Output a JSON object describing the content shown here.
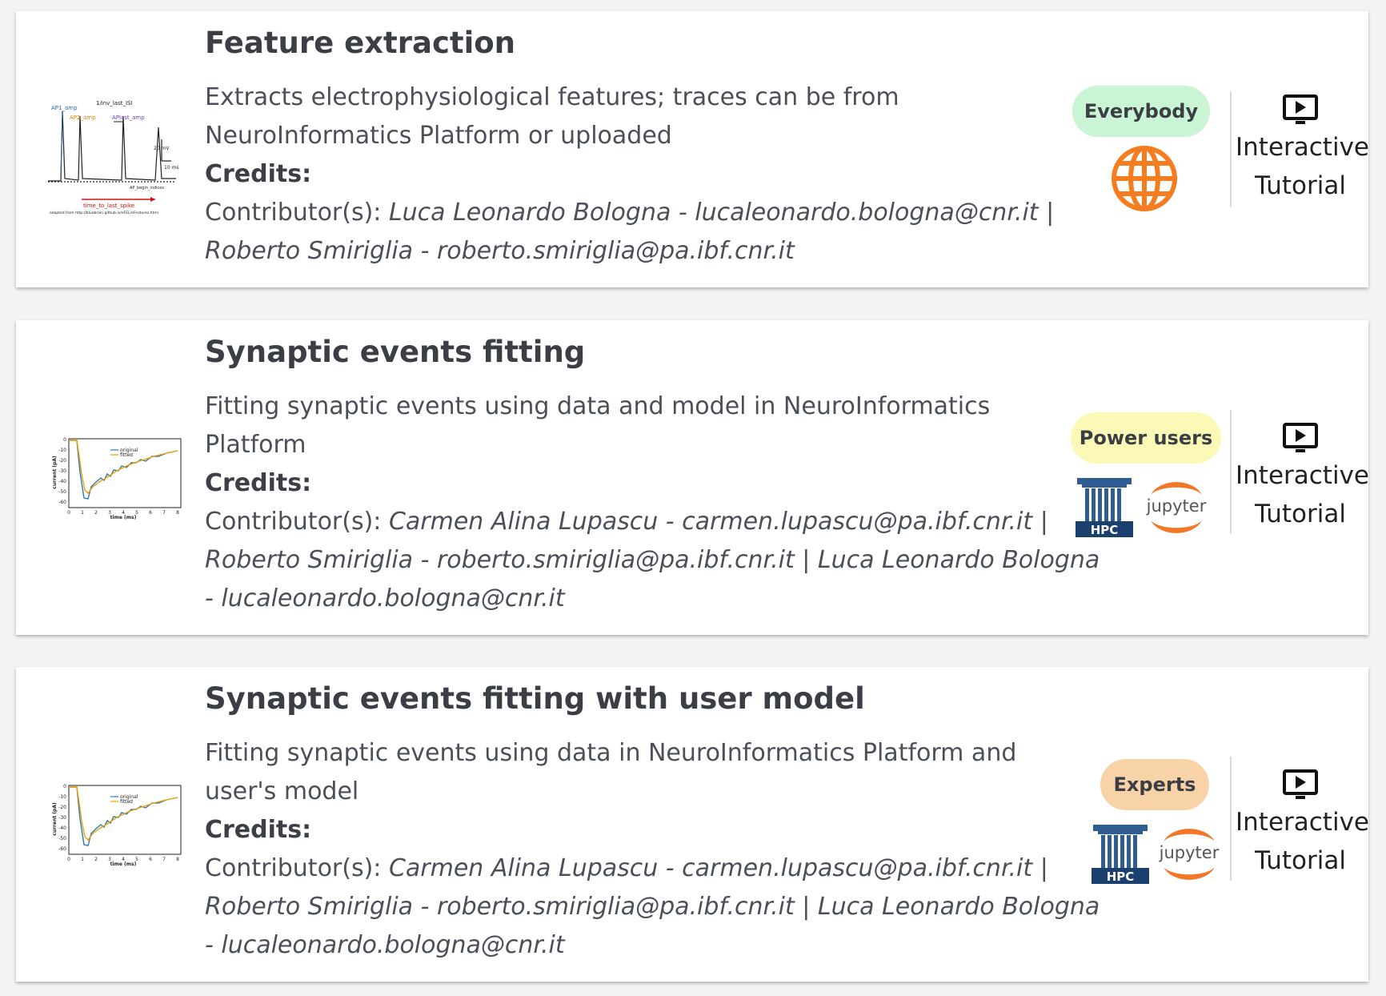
{
  "cards": [
    {
      "title": "Feature extraction",
      "description": "Extracts electrophysiological features; traces can be from NeuroInformatics Platform or uploaded",
      "credits_label": "Credits:",
      "contributors_prefix": "Contributor(s):",
      "contributors": "Luca Leonardo Bologna - lucaleonardo.bologna@cnr.it | Roberto Smiriglia - roberto.smiriglia@pa.ibf.cnr.it",
      "audience": "Everybody",
      "audience_color": "#c9f5d4",
      "platform_icons": [
        "globe-icon"
      ],
      "tutorial_label": "Interactive Tutorial",
      "thumbnail": {
        "labels": [
          "AP1_amp",
          "1/inv_last_ISI",
          "AP2_amp",
          "APlast_amp",
          "20 mV",
          "10 ms",
          "AP_begin_indices",
          "time_to_last_spike",
          "adapted from http://bluebrain.github.io/eFEL/eFeatures.html"
        ]
      }
    },
    {
      "title": "Synaptic events fitting",
      "description": "Fitting synaptic events using data and model in NeuroInformatics Platform",
      "credits_label": "Credits:",
      "contributors_prefix": "Contributor(s):",
      "contributors": "Carmen Alina Lupascu - carmen.lupascu@pa.ibf.cnr.it | Roberto Smiriglia - roberto.smiriglia@pa.ibf.cnr.it | Luca Leonardo Bologna - lucaleonardo.bologna@cnr.it",
      "audience": "Power users",
      "audience_color": "#fcf9b6",
      "platform_icons": [
        "hpc-icon",
        "jupyter-icon"
      ],
      "hpc_label": "HPC",
      "jupyter_label": "jupyter",
      "tutorial_label": "Interactive Tutorial",
      "thumbnail": {
        "legend": [
          "original",
          "fitted"
        ],
        "ylabel": "current (pA)",
        "xlabel": "time (ms)",
        "yticks": [
          "0",
          "-10",
          "-20",
          "-30",
          "-40",
          "-50",
          "-60"
        ],
        "xticks": [
          "0",
          "1",
          "2",
          "3",
          "4",
          "5",
          "6",
          "7",
          "8"
        ]
      }
    },
    {
      "title": "Synaptic events fitting with user model",
      "description": "Fitting synaptic events using data in NeuroInformatics Platform and user's model",
      "credits_label": "Credits:",
      "contributors_prefix": "Contributor(s):",
      "contributors": "Carmen Alina Lupascu - carmen.lupascu@pa.ibf.cnr.it | Roberto Smiriglia - roberto.smiriglia@pa.ibf.cnr.it | Luca Leonardo Bologna - lucaleonardo.bologna@cnr.it",
      "audience": "Experts",
      "audience_color": "#f9d3a8",
      "platform_icons": [
        "hpc-icon",
        "jupyter-icon"
      ],
      "hpc_label": "HPC",
      "jupyter_label": "jupyter",
      "tutorial_label": "Interactive Tutorial",
      "thumbnail": {
        "legend": [
          "original",
          "fitted"
        ],
        "ylabel": "current (pA)",
        "xlabel": "time (ms)",
        "yticks": [
          "0",
          "-10",
          "-20",
          "-30",
          "-40",
          "-50",
          "-60"
        ],
        "xticks": [
          "0",
          "1",
          "2",
          "3",
          "4",
          "5",
          "6",
          "7",
          "8"
        ]
      }
    }
  ]
}
